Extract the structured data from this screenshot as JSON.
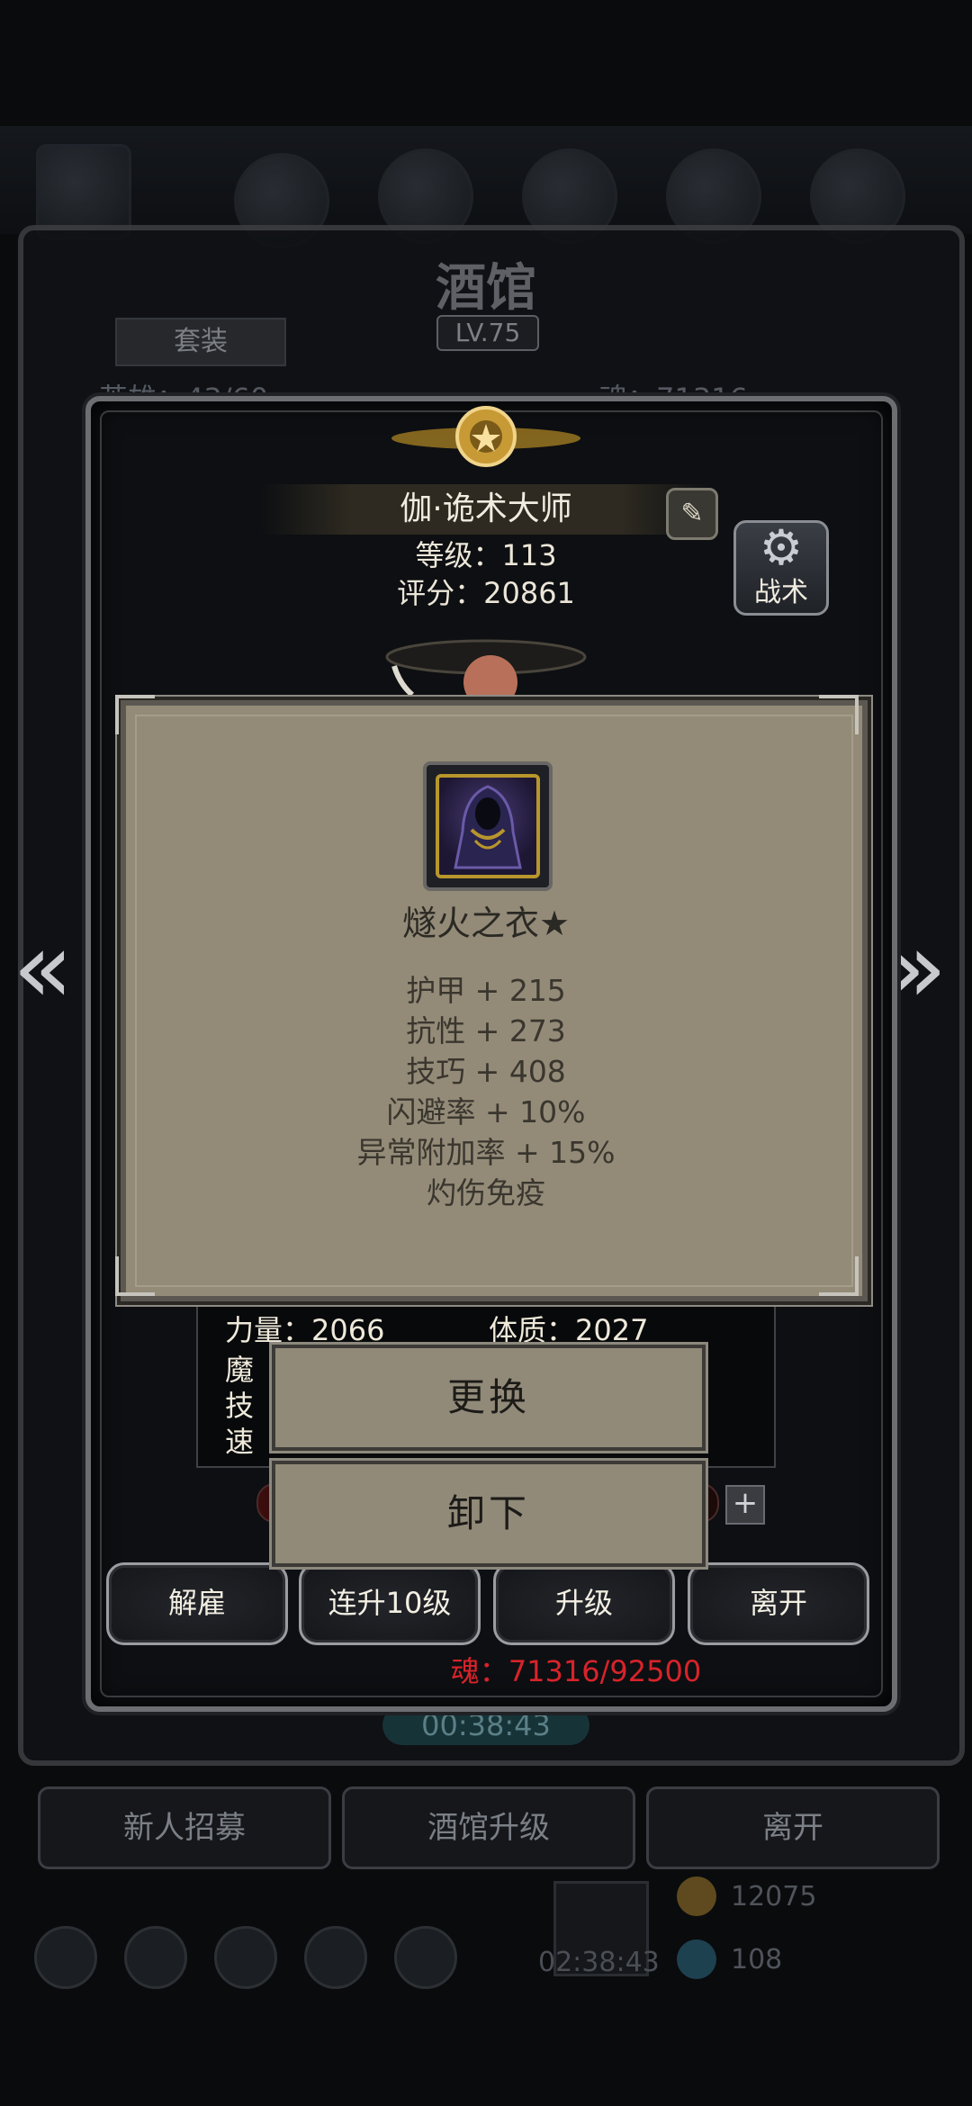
{
  "background": {
    "title": "酒馆",
    "level": "LV.75",
    "tab": "套装",
    "hero_count_partial": "英雄：43/60",
    "soul_partial": "魂：71316",
    "timer_main": "00:38:43",
    "buttons": [
      "新人招募",
      "酒馆升级",
      "离开"
    ],
    "resource_a": "12075",
    "resource_b": "108",
    "timer_secondary": "02:38:43"
  },
  "hero": {
    "name": "伽·诡术大师",
    "level_label": "等级：",
    "level": "113",
    "score_label": "评分：",
    "score": "20861",
    "tactics_label": "战术"
  },
  "stats": {
    "strength": "力量：2066",
    "constitution": "体质：2027",
    "magic_partial": "魔",
    "skill_partial": "技",
    "speed_partial": "速"
  },
  "item": {
    "name": "燧火之衣★",
    "attributes": [
      "护甲 + 215",
      "抗性 + 273",
      "技巧 + 408",
      "闪避率 + 10%",
      "异常附加率 + 15%",
      "灼伤免疫"
    ]
  },
  "popup_buttons": {
    "change": "更换",
    "unequip": "卸下"
  },
  "actions": [
    "解雇",
    "连升10级",
    "升级",
    "离开"
  ],
  "soul": {
    "label": "魂：",
    "value": "71316/92500"
  },
  "colors": {
    "soul_red": "#d8232a",
    "popup_bg": "#938b78",
    "item_gold_border": "#b8962c"
  }
}
